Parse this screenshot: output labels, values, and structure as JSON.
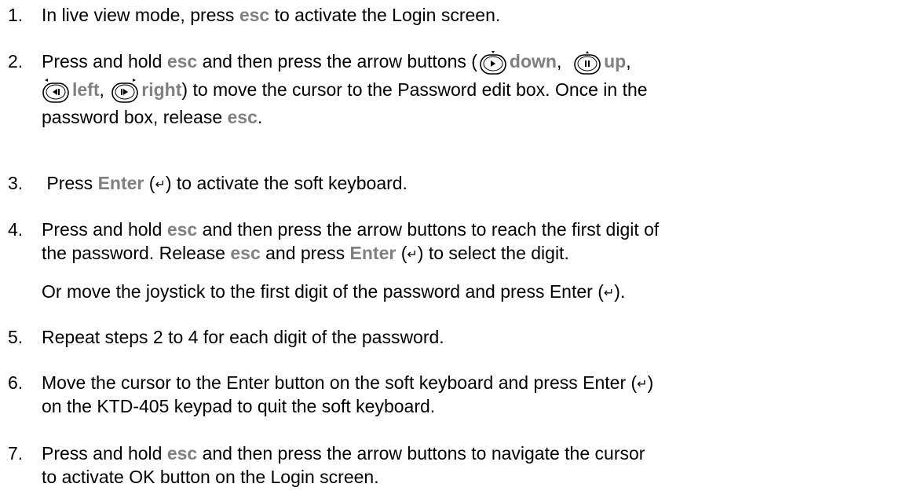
{
  "steps": [
    {
      "number": "1.",
      "lines": [
        {
          "pre": "In live view mode, press ",
          "kw": "esc",
          "post": " to activate the Login screen."
        }
      ]
    },
    {
      "number": "2.",
      "line1": {
        "a": "Press and hold ",
        "kw1": "esc",
        "b": " and then press the arrow buttons (",
        "down": "down",
        "c": ",  ",
        "up": "up",
        "d": ","
      },
      "line2": {
        "left": "left",
        "a": ", ",
        "right": "right",
        "b": ") to move the cursor to the Password edit box. Once in the"
      },
      "line3": {
        "a": "password box, release ",
        "kw": "esc",
        "b": "."
      }
    },
    {
      "number": "3.",
      "line1": {
        "a": " Press ",
        "kw": "Enter",
        "b": " (",
        "c": ") to activate the soft keyboard."
      }
    },
    {
      "number": "4.",
      "line1": {
        "a": "Press and hold ",
        "kw": "esc",
        "b": " and then press the arrow buttons to reach the first digit of"
      },
      "line2": {
        "a": "the password. Release ",
        "kw1": "esc",
        "b": " and press ",
        "kw2": "Enter",
        "c": " (",
        "d": ") to select the digit."
      },
      "line3": {
        "a": "Or move the joystick to the first digit of the password and press Enter (",
        "b": ")."
      }
    },
    {
      "number": "5.",
      "line1": {
        "a": "Repeat steps 2 to 4 for each digit of the password."
      }
    },
    {
      "number": "6.",
      "line1": {
        "a": "Move the cursor to the Enter button on the soft keyboard and press Enter (",
        "b": ")"
      },
      "line2": {
        "a": "on the KTD-405 keypad to quit the soft keyboard."
      }
    },
    {
      "number": "7.",
      "line1": {
        "a": "Press and hold ",
        "kw": "esc",
        "b": " and then press the arrow buttons to navigate the cursor"
      },
      "line2": {
        "a": "to activate OK button on the Login screen."
      }
    }
  ],
  "symbols": {
    "enter": "↵"
  },
  "icons": {
    "down": "down-arrow-button-icon",
    "up": "up-arrow-button-icon",
    "left": "left-arrow-button-icon",
    "right": "right-arrow-button-icon",
    "enter": "enter-key-icon"
  },
  "colors": {
    "keyword": "#808080",
    "text": "#000000"
  }
}
